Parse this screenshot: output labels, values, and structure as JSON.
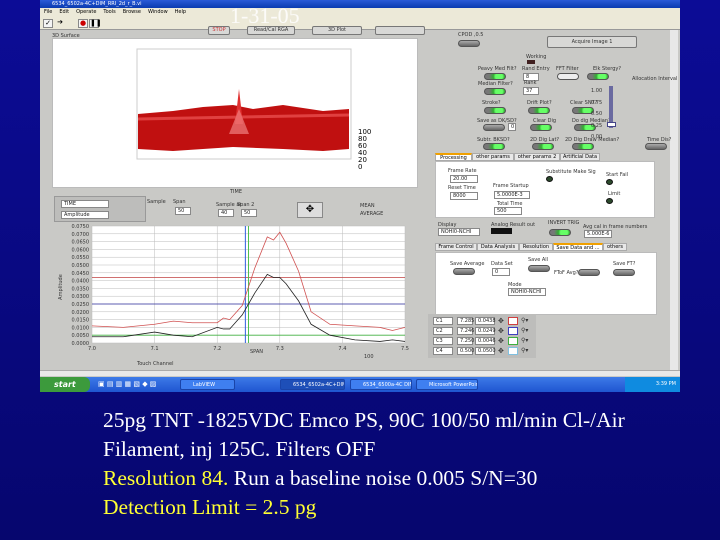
{
  "window": {
    "title": "6534_6502a-4C+DIM_RRI_2d_r_B.vi",
    "menu": [
      "File",
      "Edit",
      "Operate",
      "Tools",
      "Browse",
      "Window",
      "Help"
    ],
    "date_overlay": "1-31-05"
  },
  "top_buttons": [
    "STOP",
    "Read/Cal RGA",
    "3D Plot",
    ""
  ],
  "surface": {
    "label": "3D Surface",
    "axis_label": "TIME",
    "ticks": [
      "100",
      "80",
      "60",
      "40",
      "20",
      "0"
    ]
  },
  "graph_controls": {
    "plot_legend": [
      "TIME",
      "Amplitude"
    ],
    "sample_label": "Sample",
    "span_label": "Span",
    "span_value": "50",
    "sample_value": "49",
    "sample_at_label": "Sample at",
    "span2_label": "Span 2",
    "sample_at_value": "40",
    "span2_value": "50",
    "legend": [
      "MEAN",
      "AVERAGE"
    ]
  },
  "chart_data": {
    "type": "line",
    "xlabel": "SPAN",
    "ylabel": "Amplitude",
    "xlim": [
      7.0,
      7.5
    ],
    "ylim": [
      0.0,
      0.075
    ],
    "xticks": [
      "7.0",
      "7.1",
      "7.2",
      "7.3",
      "7.4",
      "7.5"
    ],
    "yticks": [
      "0.0750",
      "0.0700",
      "0.0650",
      "0.0600",
      "0.0550",
      "0.0500",
      "0.0450",
      "0.0400",
      "0.0350",
      "0.0300",
      "0.0250",
      "0.0200",
      "0.0150",
      "0.0100",
      "0.0050",
      "0.0000"
    ],
    "grid": true,
    "series": [
      {
        "color": "#d05050",
        "x": [
          7.0,
          7.05,
          7.1,
          7.13,
          7.16,
          7.2,
          7.21,
          7.22,
          7.24,
          7.26,
          7.28,
          7.29,
          7.3,
          7.31,
          7.33,
          7.35,
          7.38,
          7.42,
          7.46,
          7.48,
          7.5
        ],
        "y": [
          0.011,
          0.01,
          0.012,
          0.014,
          0.013,
          0.013,
          0.016,
          0.015,
          0.024,
          0.048,
          0.068,
          0.066,
          0.071,
          0.064,
          0.046,
          0.02,
          0.012,
          0.011,
          0.01,
          0.008,
          0.01
        ]
      },
      {
        "color": "#222222",
        "x": [
          7.0,
          7.05,
          7.1,
          7.13,
          7.16,
          7.2,
          7.21,
          7.22,
          7.24,
          7.26,
          7.28,
          7.29,
          7.3,
          7.31,
          7.33,
          7.35,
          7.38,
          7.42,
          7.46,
          7.48,
          7.5
        ],
        "y": [
          0.004,
          0.004,
          0.007,
          0.005,
          0.004,
          0.01,
          0.009,
          0.009,
          0.018,
          0.032,
          0.044,
          0.042,
          0.042,
          0.038,
          0.027,
          0.012,
          0.005,
          0.002,
          0.001,
          0.002,
          0.001
        ]
      }
    ],
    "cursors_h": [
      {
        "y": 0.042,
        "color": "#c04040"
      },
      {
        "y": 0.025,
        "color": "#3030a0"
      },
      {
        "y": 0.005,
        "color": "#40b040"
      }
    ],
    "cursors_v": [
      {
        "x": 7.245,
        "color": "#3060e0"
      },
      {
        "x": 7.25,
        "color": "#50c050"
      }
    ],
    "footer_value": "100"
  },
  "right": {
    "cpu_label": "CPOD ,0.5",
    "acquire": "Acquire Image 1",
    "working": "Working",
    "row1": [
      "Peavy Med Filt?",
      "Rand Entry",
      "FFT Filter",
      "Elk Stergy?"
    ],
    "rand_value": "8",
    "median": "Median Filter?",
    "rank_label": "Rank",
    "rank_value": "37",
    "row3": [
      "Stroke?",
      "Drift Plot?",
      "Clear SNT?"
    ],
    "row4": [
      "Save as DK/SD?",
      "Clear Dig",
      "Do dig Median?"
    ],
    "save_value": "0",
    "row5": [
      "Subtr. BKSD?",
      "2D Dig Lat?",
      "2D Dig Draw Median?",
      "Time Dis?"
    ],
    "slider": {
      "label": "Allocation Interval",
      "ticks": [
        "1.00",
        "0.75",
        "0.50",
        "0.25",
        "0.00"
      ],
      "value": 0.0
    },
    "tabs1": [
      "Processing",
      "other params",
      "other params 2",
      "Artificial Data"
    ],
    "frame_rate_label": "Frame Rate",
    "frame_rate": "20.00",
    "reset_time_label": "Reset Time",
    "reset_time": "8000",
    "frame_startup_label": "Frame Startup",
    "frame_startup": "5.0000E-3",
    "total_time_label": "Total Time",
    "total_time": "500",
    "subst_label": "Substitute Make Sig",
    "start_fail": "Start Fail",
    "limit": "Limit",
    "display_label": "Display",
    "display_value": "NOHI0-NCHI",
    "analog_label": "Analog Result out",
    "invert_label": "INVERT TRIG",
    "avg_label": "Avg cal in frame numbers",
    "avg_value": "5.000E-6",
    "tabs2": [
      "Frame Control",
      "Data Analysis",
      "Resolution",
      "Save Data and ...",
      "others"
    ],
    "save_avg": "Save Average",
    "data_set": "Data Set",
    "data_set_value": "0",
    "save_all": "Save All",
    "fft_avg": "FToF Avg?",
    "save_fft": "Save FT?",
    "mode_label": "Mode",
    "mode_value": "NOHI0-NCHI"
  },
  "cursor_table": [
    [
      "C1",
      "7.285",
      "0.0438"
    ],
    [
      "C2",
      "7.246",
      "0.0249"
    ],
    [
      "C3",
      "7.250",
      "0.0046"
    ],
    [
      "C4",
      "0.500",
      "0.0500"
    ]
  ],
  "bottom_label": "Touch Channel",
  "taskbar": {
    "start": "start",
    "tasks": [
      "LabVIEW",
      "6534_6502a-4C+DIM...",
      "6534_6500a-4C DIM...",
      "Microsoft PowerPoint - ..."
    ],
    "clock": "3:39 PM"
  },
  "slide_text": {
    "line1": "25pg TNT  -1825VDC Emco PS, 90C 100/50 ml/min Cl-/Air",
    "line2": "Filament, inj 125C. Filters OFF",
    "line3a": "Resolution 84.",
    "line3b": " Run a  baseline noise 0.005 S/N=30",
    "line4": "Detection Limit = 2.5 pg"
  }
}
